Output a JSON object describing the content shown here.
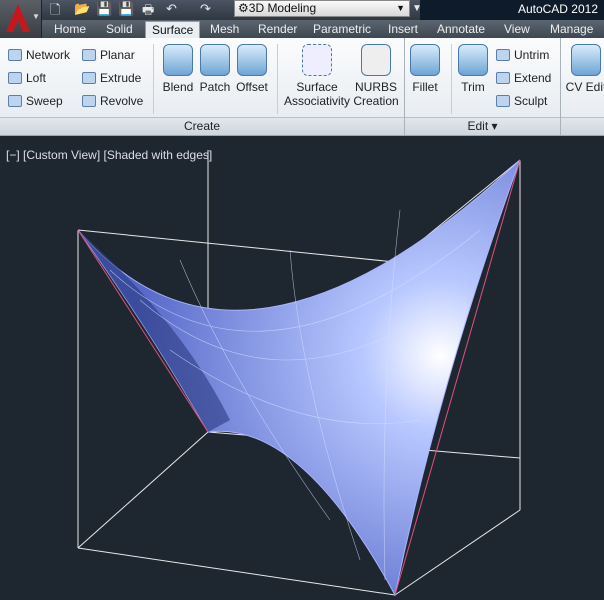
{
  "quick_access": {
    "workspace": "3D Modeling",
    "app_title": "AutoCAD 2012"
  },
  "tabs": [
    "Home",
    "Solid",
    "Surface",
    "Mesh",
    "Render",
    "Parametric",
    "Insert",
    "Annotate",
    "View",
    "Manage"
  ],
  "active_tab": "Surface",
  "ribbon": {
    "create_small": [
      "Network",
      "Loft",
      "Sweep",
      "Planar",
      "Extrude",
      "Revolve"
    ],
    "create_large": [
      "Blend",
      "Patch",
      "Offset"
    ],
    "surface_assoc": [
      "Surface",
      "Associativity"
    ],
    "nurbs": [
      "NURBS",
      "Creation"
    ],
    "fillet": "Fillet",
    "trim": "Trim",
    "edit_small": [
      "Untrim",
      "Extend",
      "Sculpt"
    ],
    "cv_edit": "CV Edit",
    "panel_create": "Create",
    "panel_edit": "Edit ▾"
  },
  "viewport": {
    "label": "[−] [Custom View] [Shaded with edges]"
  }
}
